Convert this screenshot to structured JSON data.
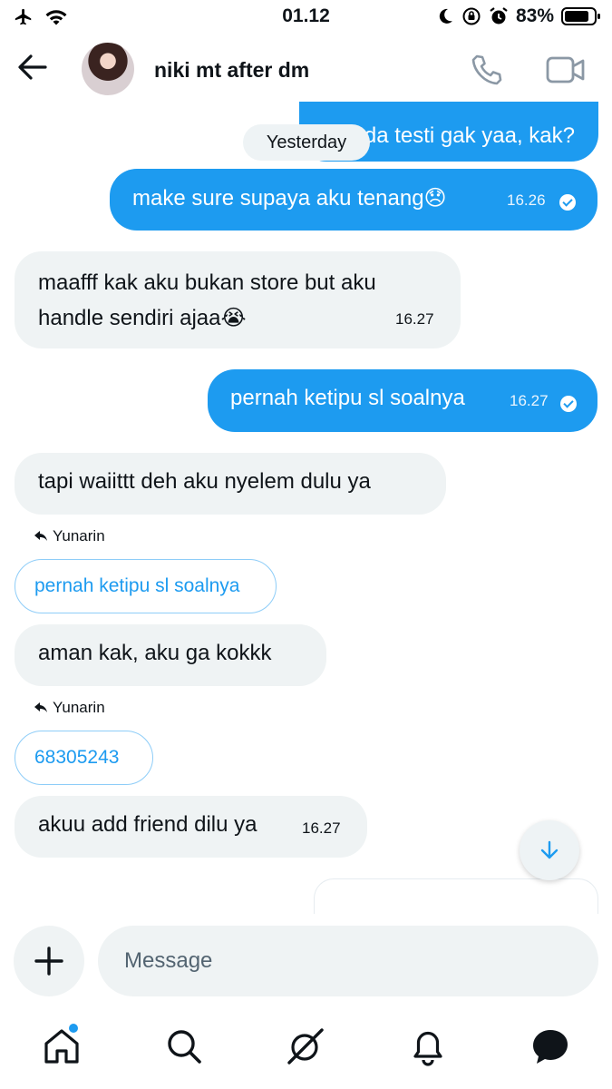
{
  "status": {
    "time": "01.12",
    "battery": "83%"
  },
  "header": {
    "title": "niki mt after dm"
  },
  "date_separator": "Yesterday",
  "messages": [
    {
      "side": "out",
      "text": "ada testi gak yaa, kak?"
    },
    {
      "side": "out",
      "text": "make sure supaya aku tenang😞",
      "time": "16.26",
      "seen": true
    },
    {
      "side": "in",
      "line1": "maafff kak aku bukan store but aku",
      "line2": "handle sendiri ajaa😭",
      "time": "16.27"
    },
    {
      "side": "out",
      "text": "pernah ketipu sl soalnya",
      "time": "16.27",
      "seen": true
    },
    {
      "side": "in",
      "text": "tapi waiittt deh aku nyelem dulu ya"
    },
    {
      "side": "in",
      "reply_to": "Yunarin",
      "quoted": "pernah ketipu sl soalnya",
      "text": "aman kak, aku ga kokkk"
    },
    {
      "side": "in",
      "reply_to": "Yunarin",
      "quoted": "68305243",
      "text": "akuu add friend dilu ya",
      "time": "16.27"
    }
  ],
  "composer": {
    "placeholder": "Message"
  },
  "tabs": [
    "home-icon",
    "search-icon",
    "grok-icon",
    "bell-icon",
    "messages-icon"
  ],
  "colors": {
    "accent": "#1d9bf0",
    "incoming_bubble": "#eff3f4",
    "text": "#0f1419"
  }
}
